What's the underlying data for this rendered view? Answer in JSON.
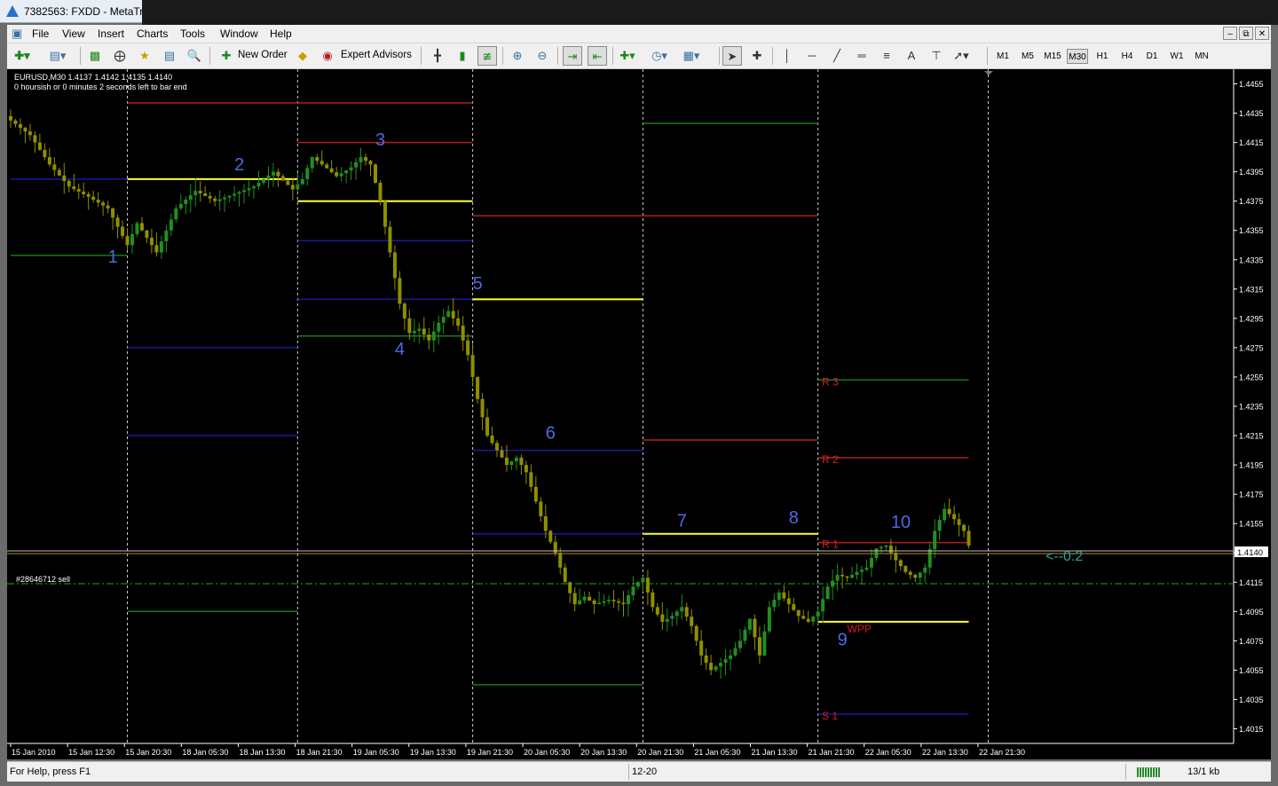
{
  "window": {
    "title": "7382563: FXDD - MetaTr"
  },
  "menu": {
    "items": [
      "File",
      "View",
      "Insert",
      "Charts",
      "Tools",
      "Window",
      "Help"
    ]
  },
  "toolbar": {
    "new_order_label": "New Order",
    "expert_advisors_label": "Expert Advisors",
    "timeframes": [
      "M1",
      "M5",
      "M15",
      "M30",
      "H1",
      "H4",
      "D1",
      "W1",
      "MN"
    ],
    "selected_timeframe": "M30"
  },
  "chart": {
    "symbol_info": "EURUSD,M30  1.4137 1.4142 1.4135 1.4140",
    "timer_text": "0 hoursish or 0 minutes 2 seconds left to bar end",
    "order_label": "#28646712 sell",
    "price_ticks": [
      "1.4455",
      "1.4435",
      "1.4415",
      "1.4395",
      "1.4375",
      "1.4355",
      "1.4335",
      "1.4315",
      "1.4295",
      "1.4275",
      "1.4255",
      "1.4235",
      "1.4215",
      "1.4195",
      "1.4175",
      "1.4155",
      "1.4135",
      "1.4115",
      "1.4095",
      "1.4075",
      "1.4055",
      "1.4035",
      "1.4015"
    ],
    "time_ticks": [
      "15 Jan 2010",
      "15 Jan 12:30",
      "15 Jan 20:30",
      "18 Jan 05:30",
      "18 Jan 13:30",
      "18 Jan 21:30",
      "19 Jan 05:30",
      "19 Jan 13:30",
      "19 Jan 21:30",
      "20 Jan 05:30",
      "20 Jan 13:30",
      "20 Jan 21:30",
      "21 Jan 05:30",
      "21 Jan 13:30",
      "21 Jan 21:30",
      "22 Jan 05:30",
      "22 Jan 13:30",
      "22 Jan 21:30"
    ],
    "current_price": "1.4140",
    "annotations": [
      "1",
      "2",
      "3",
      "4",
      "5",
      "6",
      "7",
      "8",
      "9",
      "10"
    ],
    "level_labels": [
      "R 3",
      "R 2",
      "R 1",
      "S 1",
      "WPP"
    ],
    "countdown_text": "<--0:2",
    "colors": {
      "background": "#000000",
      "bull": "#1f8f1f",
      "bear": "#8f8f00",
      "pivot": "#ffff33",
      "resistance": "#b02020",
      "support_blue": "#1a1aa0",
      "support_green": "#1a7a1a",
      "annotation": "#4a6be0"
    }
  },
  "chart_data": {
    "type": "candlestick",
    "symbol": "EURUSD",
    "timeframe": "M30",
    "y_range": [
      1.4005,
      1.4465
    ],
    "close_path": [
      [
        0,
        1.443
      ],
      [
        4,
        1.442
      ],
      [
        8,
        1.44
      ],
      [
        12,
        1.4385
      ],
      [
        16,
        1.4378
      ],
      [
        20,
        1.437
      ],
      [
        24,
        1.4345
      ],
      [
        26,
        1.436
      ],
      [
        30,
        1.434
      ],
      [
        34,
        1.437
      ],
      [
        38,
        1.4382
      ],
      [
        42,
        1.4375
      ],
      [
        46,
        1.438
      ],
      [
        50,
        1.4385
      ],
      [
        54,
        1.4395
      ],
      [
        58,
        1.4383
      ],
      [
        60,
        1.439
      ],
      [
        62,
        1.4405
      ],
      [
        64,
        1.44
      ],
      [
        67,
        1.4392
      ],
      [
        70,
        1.4398
      ],
      [
        72,
        1.4405
      ],
      [
        74,
        1.44
      ],
      [
        76,
        1.4375
      ],
      [
        78,
        1.434
      ],
      [
        80,
        1.4305
      ],
      [
        82,
        1.4285
      ],
      [
        84,
        1.4288
      ],
      [
        86,
        1.428
      ],
      [
        88,
        1.4292
      ],
      [
        90,
        1.43
      ],
      [
        92,
        1.429
      ],
      [
        94,
        1.427
      ],
      [
        96,
        1.424
      ],
      [
        98,
        1.4215
      ],
      [
        100,
        1.4205
      ],
      [
        102,
        1.4195
      ],
      [
        104,
        1.42
      ],
      [
        106,
        1.419
      ],
      [
        108,
        1.417
      ],
      [
        110,
        1.415
      ],
      [
        112,
        1.4135
      ],
      [
        114,
        1.4115
      ],
      [
        116,
        1.41
      ],
      [
        118,
        1.4105
      ],
      [
        120,
        1.41
      ],
      [
        123,
        1.4103
      ],
      [
        126,
        1.41
      ],
      [
        128,
        1.4112
      ],
      [
        130,
        1.4118
      ],
      [
        132,
        1.4098
      ],
      [
        134,
        1.4088
      ],
      [
        136,
        1.4092
      ],
      [
        138,
        1.4098
      ],
      [
        140,
        1.4085
      ],
      [
        142,
        1.4065
      ],
      [
        144,
        1.4055
      ],
      [
        146,
        1.406
      ],
      [
        148,
        1.4065
      ],
      [
        150,
        1.4075
      ],
      [
        152,
        1.409
      ],
      [
        154,
        1.4065
      ],
      [
        156,
        1.4098
      ],
      [
        158,
        1.4108
      ],
      [
        160,
        1.41
      ],
      [
        162,
        1.4092
      ],
      [
        164,
        1.4088
      ],
      [
        166,
        1.4095
      ],
      [
        168,
        1.4112
      ],
      [
        170,
        1.412
      ],
      [
        172,
        1.4118
      ],
      [
        174,
        1.4122
      ],
      [
        176,
        1.4125
      ],
      [
        178,
        1.4138
      ],
      [
        180,
        1.414
      ],
      [
        182,
        1.413
      ],
      [
        184,
        1.4122
      ],
      [
        186,
        1.4118
      ],
      [
        188,
        1.4125
      ],
      [
        190,
        1.415
      ],
      [
        192,
        1.4165
      ],
      [
        194,
        1.4158
      ],
      [
        196,
        1.415
      ],
      [
        197,
        1.414
      ]
    ],
    "sessions": [
      {
        "x": [
          0,
          24
        ],
        "pp": null,
        "r1": null,
        "r2": null,
        "s1": 1.439,
        "s2": 1.4338
      },
      {
        "x": [
          24,
          59
        ],
        "pp": 1.439,
        "r1": 1.4442,
        "r2": null,
        "s1": 1.4275,
        "s2": 1.4215,
        "s3": 1.4095
      },
      {
        "x": [
          59,
          95
        ],
        "pp": 1.4375,
        "r1": 1.4442,
        "r2": 1.4415,
        "s1": 1.4348,
        "s2": 1.4308,
        "s3": 1.4283
      },
      {
        "x": [
          95,
          130
        ],
        "pp": 1.4308,
        "r1": 1.4365,
        "s1": 1.4205,
        "s2": 1.4148,
        "s3": 1.4045
      },
      {
        "x": [
          130,
          166
        ],
        "pp": 1.4148,
        "r1": 1.4365,
        "r2": 1.4212,
        "s1": 1.4428
      },
      {
        "x": [
          166,
          197
        ],
        "pp": 1.4088,
        "r1": 1.4142,
        "r2": 1.42,
        "r3": 1.4253,
        "s1": 1.4025
      }
    ],
    "pivot_level_values": {
      "R3": 1.4253,
      "R2": 1.42,
      "R1": 1.4142,
      "WPP": 1.4088,
      "S1": 1.4025
    },
    "order_level": 1.4118,
    "current_price": 1.414
  }
}
